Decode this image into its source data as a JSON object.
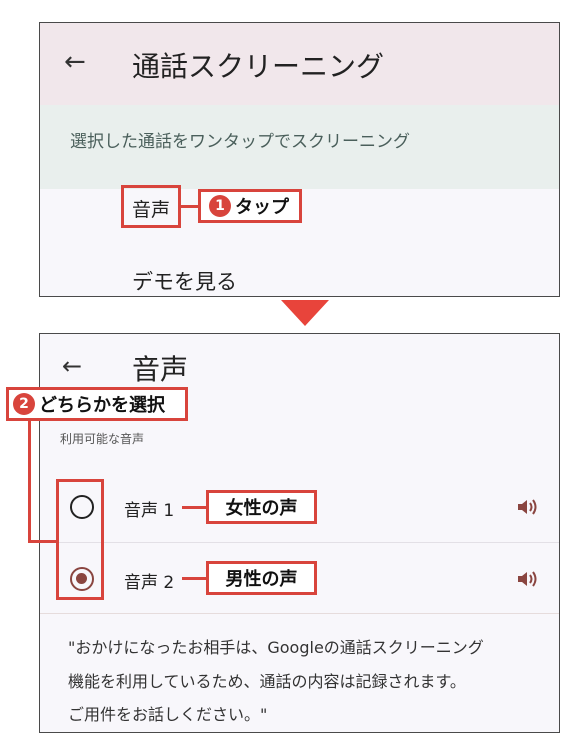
{
  "panel1": {
    "title": "通話スクリーニング",
    "subtitle": "選択した通話をワンタップでスクリーニング",
    "voice_item": "音声",
    "demo_item": "デモを見る"
  },
  "annotation1": {
    "number": "1",
    "text": "タップ"
  },
  "panel2": {
    "title": "音声",
    "section_label": "利用可能な音声",
    "voices": [
      {
        "label": "音声 1",
        "selected": false
      },
      {
        "label": "音声 2",
        "selected": true
      }
    ],
    "description_lines": [
      "\"おかけになったお相手は、Googleの通話スクリーニング",
      "機能を利用しているため、通話の内容は記録されます。",
      "ご用件をお話しください。\""
    ]
  },
  "annotation2": {
    "number": "2",
    "text": "どちらかを選択"
  },
  "voice_notes": [
    "女性の声",
    "男性の声"
  ],
  "colors": {
    "annotation": "#d8443c",
    "radio_selected": "#8a4540",
    "header_bg": "#f1e7eb",
    "subheader_bg": "#e9efed"
  },
  "icons": {
    "back": "arrow-left-icon",
    "speaker": "speaker-icon"
  }
}
